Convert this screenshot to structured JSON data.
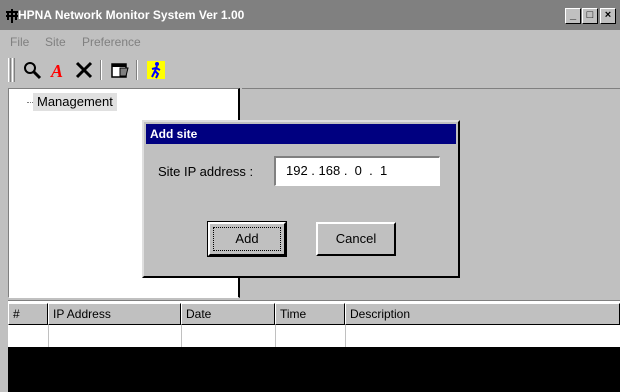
{
  "window": {
    "title": "HPNA Network Monitor System Ver 1.00",
    "icon": "network-app-icon",
    "controls": {
      "minimize": "_",
      "maximize": "□",
      "close": "×"
    }
  },
  "menu": {
    "items": [
      "File",
      "Site",
      "Preference"
    ]
  },
  "toolbar": {
    "buttons": [
      "search-icon",
      "font-icon",
      "delete-icon",
      "properties-icon",
      "run-icon"
    ],
    "colors": {
      "font": "#ff0000",
      "run_bg": "#ffff00",
      "run_fig": "#0000ff"
    }
  },
  "tree": {
    "items": [
      {
        "label": "Management",
        "selected": true
      }
    ]
  },
  "dialog": {
    "title": "Add site",
    "field_label": "Site IP address :",
    "ip_value": "192 . 168 .  0  .  1",
    "add_label": "Add",
    "cancel_label": "Cancel"
  },
  "list": {
    "columns": [
      "#",
      "IP Address",
      "Date",
      "Time",
      "Description"
    ]
  },
  "colors": {
    "dialog_title_bg": "#000080",
    "titlebar_bg": "#808080",
    "face": "#c0c0c0"
  }
}
